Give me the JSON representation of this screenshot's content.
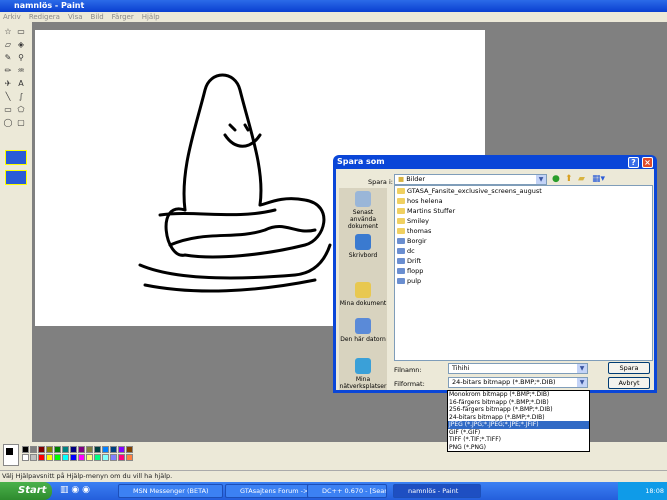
{
  "window": {
    "title": "namnlös - Paint"
  },
  "menu": [
    "Arkiv",
    "Redigera",
    "Visa",
    "Bild",
    "Färger",
    "Hjälp"
  ],
  "tools": [
    "free-select",
    "rect-select",
    "eraser",
    "fill",
    "picker",
    "magnifier",
    "pencil",
    "brush",
    "airbrush",
    "text",
    "line",
    "curve",
    "rectangle",
    "polygon",
    "ellipse",
    "rounded-rect"
  ],
  "palette": {
    "top": [
      "#000000",
      "#808080",
      "#800000",
      "#808000",
      "#008000",
      "#008080",
      "#000080",
      "#800080",
      "#808040",
      "#004040",
      "#0080ff",
      "#004080",
      "#8000ff",
      "#804000"
    ],
    "bottom": [
      "#ffffff",
      "#c0c0c0",
      "#ff0000",
      "#ffff00",
      "#00ff00",
      "#00ffff",
      "#0000ff",
      "#ff00ff",
      "#ffff80",
      "#00ff80",
      "#80ffff",
      "#8080ff",
      "#ff0080",
      "#ff8040"
    ]
  },
  "status": "Välj Hjälpavsnitt på Hjälp-menyn om du vill ha hjälp.",
  "dialog": {
    "title": "Spara som",
    "save_in_label": "Spara i:",
    "save_in_value": "Bilder",
    "places": [
      "Senast använda dokument",
      "Skrivbord",
      "Mina dokument",
      "Den här datorn",
      "Mina nätverksplatser"
    ],
    "files": [
      {
        "name": "GTASA_Fansite_exclusive_screens_august",
        "type": "folder"
      },
      {
        "name": "hos helena",
        "type": "folder"
      },
      {
        "name": "Martins Stuffer",
        "type": "folder"
      },
      {
        "name": "Smiley",
        "type": "folder"
      },
      {
        "name": "thomas",
        "type": "folder"
      },
      {
        "name": "Borgir",
        "type": "image"
      },
      {
        "name": "dc",
        "type": "image"
      },
      {
        "name": "Drift",
        "type": "image"
      },
      {
        "name": "flopp",
        "type": "image"
      },
      {
        "name": "pulp",
        "type": "image"
      }
    ],
    "filename_label": "Filnamn:",
    "filename_value": "Tihihi",
    "format_label": "Filformat:",
    "format_value": "24-bitars bitmapp (*.BMP;*.DIB)",
    "save_button": "Spara",
    "cancel_button": "Avbryt",
    "format_options": [
      "Monokrom bitmapp (*.BMP;*.DIB)",
      "16-färgers bitmapp (*.BMP;*.DIB)",
      "256-färgers bitmapp (*.BMP;*.DIB)",
      "24-bitars bitmapp (*.BMP;*.DIB)",
      "JPEG (*.JPG;*.JPEG;*.JPE;*.JFIF)",
      "GIF (*.GIF)",
      "TIFF (*.TIF;*.TIFF)",
      "PNG (*.PNG)"
    ],
    "highlighted_option": "JPEG (*.JPG;*.JPEG;*.JPE;*.JFIF)"
  },
  "taskbar": {
    "start": "Start",
    "tasks": [
      "MSN Messenger (BETA)",
      "GTAsajtens Forum ->...",
      "DC++ 0.670 - [Searc...",
      "namnlös - Paint"
    ],
    "clock": "18:08"
  }
}
